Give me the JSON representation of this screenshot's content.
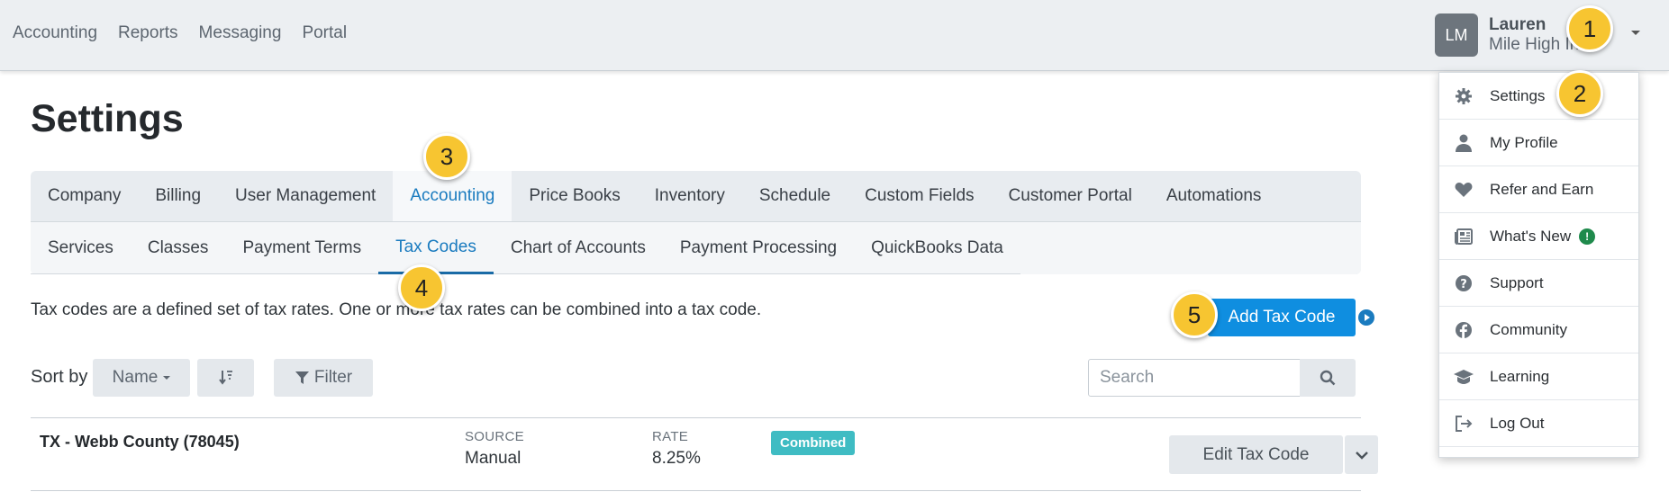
{
  "topnav": [
    "Accounting",
    "Reports",
    "Messaging",
    "Portal"
  ],
  "user": {
    "initials": "LM",
    "name": "Lauren",
    "company": "Mile High In..."
  },
  "menu": [
    {
      "label": "Settings",
      "icon": "gear-icon"
    },
    {
      "label": "My Profile",
      "icon": "person-icon"
    },
    {
      "label": "Refer and Earn",
      "icon": "heart-icon"
    },
    {
      "label": "What's New",
      "icon": "newspaper-icon",
      "badge": "!"
    },
    {
      "label": "Support",
      "icon": "question-circle-icon"
    },
    {
      "label": "Community",
      "icon": "facebook-icon"
    },
    {
      "label": "Learning",
      "icon": "graduation-cap-icon"
    },
    {
      "label": "Log Out",
      "icon": "logout-icon"
    }
  ],
  "callouts": [
    "1",
    "2",
    "3",
    "4",
    "5"
  ],
  "page_title": "Settings",
  "tabs": [
    "Company",
    "Billing",
    "User Management",
    "Accounting",
    "Price Books",
    "Inventory",
    "Schedule",
    "Custom Fields",
    "Customer Portal",
    "Automations"
  ],
  "active_tab": "Accounting",
  "subtabs": [
    "Services",
    "Classes",
    "Payment Terms",
    "Tax Codes",
    "Chart of Accounts",
    "Payment Processing",
    "QuickBooks Data"
  ],
  "active_subtab": "Tax Codes",
  "description": "Tax codes are a defined set of tax rates. One or more tax rates can be combined into a tax code.",
  "add_button": "Add Tax Code",
  "sort": {
    "label": "Sort by",
    "field": "Name",
    "filter": "Filter"
  },
  "search": {
    "placeholder": "Search"
  },
  "tax_codes": [
    {
      "name": "TX - Webb County (78045)",
      "source_label": "SOURCE",
      "source": "Manual",
      "rate_label": "RATE",
      "rate": "8.25%",
      "tag": "Combined",
      "edit_label": "Edit Tax Code"
    }
  ],
  "colors": {
    "primary": "#0f8ee0",
    "accent": "#1a7bbf",
    "callout": "#f7c531",
    "tag": "#3fbcc3"
  }
}
